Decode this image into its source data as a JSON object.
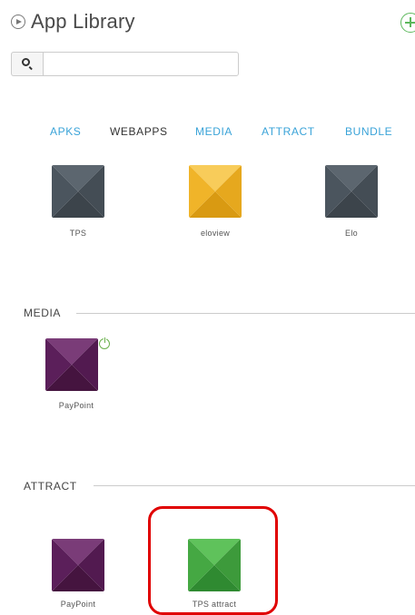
{
  "header": {
    "title": "App Library",
    "play_icon": "play-circle-icon",
    "add_icon": "plus-circle-icon"
  },
  "search": {
    "placeholder": "",
    "value": "",
    "icon": "search-icon"
  },
  "tabs": [
    {
      "label": "APKS",
      "active": false
    },
    {
      "label": "WEBAPPS",
      "active": true
    },
    {
      "label": "MEDIA",
      "active": false
    },
    {
      "label": "ATTRACT",
      "active": false
    },
    {
      "label": "BUNDLE",
      "active": false
    }
  ],
  "webapps": [
    {
      "label": "TPS",
      "color": "#4b555e"
    },
    {
      "label": "eloview",
      "color": "#f0b429"
    },
    {
      "label": "Elo",
      "color": "#4b555e"
    }
  ],
  "media": {
    "title": "MEDIA",
    "items": [
      {
        "label": "PayPoint",
        "color": "#5b1f5a",
        "status_icon": "power-icon"
      }
    ]
  },
  "attract": {
    "title": "ATTRACT",
    "items": [
      {
        "label": "PayPoint",
        "color": "#5b1f5a"
      },
      {
        "label": "TPS attract",
        "color": "#45a843",
        "highlighted": true
      }
    ]
  },
  "colors": {
    "tab_link": "#3aa3d8",
    "tab_active": "#333333",
    "highlight_border": "#e00000",
    "add_green": "#5cb85c"
  }
}
